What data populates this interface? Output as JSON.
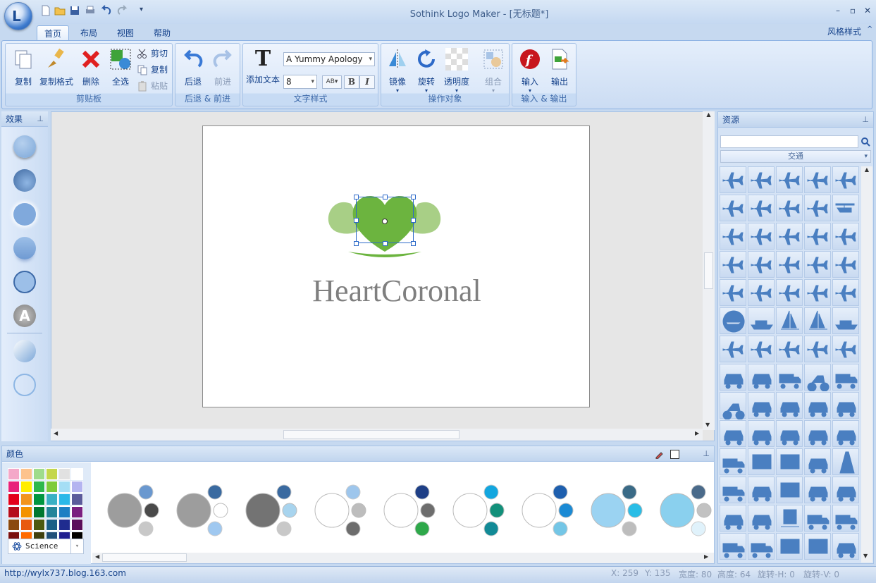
{
  "window": {
    "title": "Sothink Logo Maker - [无标题*]",
    "style_menu": "风格样式",
    "orb_letter": "L"
  },
  "tabs": [
    "首页",
    "布局",
    "视图",
    "帮助"
  ],
  "groups": {
    "clipboard": {
      "label": "剪贴板",
      "copy": "复制",
      "format_painter": "复制格式",
      "delete": "删除",
      "select_all": "全选",
      "cut": "剪切",
      "copy_small": "复制",
      "paste": "粘贴"
    },
    "history": {
      "label": "后退 & 前进",
      "undo": "后退",
      "redo": "前进"
    },
    "text": {
      "label": "文字样式",
      "add_text": "添加文本",
      "font": "A Yummy Apology",
      "size": "8",
      "bold": "B",
      "italic": "I",
      "spacing": "AB"
    },
    "objects": {
      "label": "操作对象",
      "mirror": "镜像",
      "rotate": "旋转",
      "opacity": "透明度",
      "group": "组合"
    },
    "io": {
      "label": "输入 & 输出",
      "import": "输入",
      "export": "输出"
    }
  },
  "effects": {
    "title": "效果",
    "text_effect_letter": "A"
  },
  "canvas": {
    "logo_text": "HeartCoronal"
  },
  "colors": {
    "title": "颜色",
    "theme": "Science",
    "palette": [
      "#f4a8c8",
      "#fdc38c",
      "#9fdc8c",
      "#c4d74b",
      "#e1e1e1",
      "#ffffff",
      "#e8237a",
      "#ffed00",
      "#2db84c",
      "#7ecb3b",
      "#a5def5",
      "#b4b4f0",
      "#e3001b",
      "#f2951d",
      "#009640",
      "#3ab0c4",
      "#2bb8e8",
      "#5b5b9b",
      "#b40d1b",
      "#f39200",
      "#00782f",
      "#23859a",
      "#1e7fc3",
      "#7a1f80",
      "#8a4a0f",
      "#e85a0f",
      "#4d5a0f",
      "#1a5f86",
      "#1f2c8f",
      "#5a0f5a",
      "#7a0f0f",
      "#ff6a00",
      "#3f3f0f",
      "#1f4f7a",
      "#1f1f8f",
      "#000000"
    ]
  },
  "schemes": [
    {
      "big": "#9d9d9d",
      "a": "#6a98cf",
      "b": "#4a4a4a",
      "c": "#c8c8c8"
    },
    {
      "big": "#9d9d9d",
      "a": "#3a6aa0",
      "b": "#ffffff",
      "c": "#9fc8f0"
    },
    {
      "big": "#737373",
      "a": "#3a6aa0",
      "b": "#a8d4ee",
      "c": "#c8c8c8"
    },
    {
      "big": "#ffffff",
      "a": "#9ec6ec",
      "b": "#bdbdbd",
      "c": "#6d6d6d"
    },
    {
      "big": "#ffffff",
      "a": "#1e3f86",
      "b": "#6d6d6d",
      "c": "#2ea84a"
    },
    {
      "big": "#ffffff",
      "a": "#12a6df",
      "b": "#12907a",
      "c": "#128a96"
    },
    {
      "big": "#ffffff",
      "a": "#1e5fae",
      "b": "#1b8ad4",
      "c": "#74c6e6"
    },
    {
      "big": "#9bd3f2",
      "a": "#3a6a86",
      "b": "#29bde6",
      "c": "#bdbdbd"
    },
    {
      "big": "#8ad0ee",
      "a": "#4a6a8a",
      "b": "#c2c2c2",
      "c": "#e0f2fb"
    }
  ],
  "resources": {
    "title": "资源",
    "category": "交通",
    "search_placeholder": ""
  },
  "status": {
    "url": "http://wylx737.blog.163.com",
    "x": "X: 259",
    "y": "Y: 135",
    "width": "宽度: 80",
    "height": "高度: 64",
    "rot_h": "旋转-H: 0",
    "rot_v": "旋转-V: 0"
  },
  "colors_accent": {
    "ribbon": "#15428b",
    "heart_dark": "#6cb43f",
    "heart_light": "#a8cf86",
    "icon_blue": "#4a7fc1"
  }
}
